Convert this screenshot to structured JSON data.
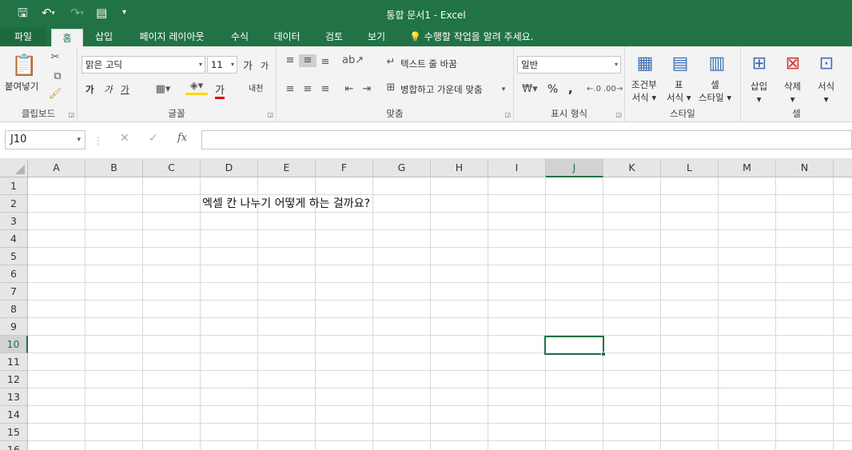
{
  "window": {
    "title": "통합 문서1 - Excel"
  },
  "qat": {
    "save_icon": "save-icon",
    "undo_icon": "undo-icon",
    "redo_icon": "redo-icon",
    "form_icon": "form-icon",
    "customize_icon": "customize-icon"
  },
  "tabs": [
    "파일",
    "홈",
    "삽입",
    "페이지 레이아웃",
    "수식",
    "데이터",
    "검토",
    "보기"
  ],
  "active_tab": "홈",
  "tell_me": "수행할 작업을 알려 주세요.",
  "ribbon": {
    "clipboard": {
      "label": "클립보드",
      "paste": "붙여넣기"
    },
    "font": {
      "label": "글꼴",
      "name": "맑은 고딕",
      "size": "11",
      "grow": "가",
      "shrink": "가",
      "bold": "가",
      "italic": "가",
      "underline": "가",
      "font_color": "가",
      "phonetic": "내천"
    },
    "alignment": {
      "label": "맞춤",
      "wrap_text": "텍스트 줄 바꿈",
      "merge_center": "병합하고 가운데 맞춤"
    },
    "number": {
      "label": "표시 형식",
      "format": "일반",
      "percent": "%",
      "comma": ","
    },
    "styles": {
      "label": "스타일",
      "cond_format": [
        "조건부",
        "서식"
      ],
      "format_table": [
        "표",
        "서식"
      ],
      "cell_styles": [
        "셀",
        "스타일"
      ]
    },
    "cells": {
      "label": "셀",
      "insert": "삽입",
      "delete": "삭제",
      "format": "서식"
    }
  },
  "formula_bar": {
    "name_box": "J10",
    "cancel": "✕",
    "enter": "✓",
    "fx": "fx",
    "value": ""
  },
  "sheet": {
    "columns": [
      "A",
      "B",
      "C",
      "D",
      "E",
      "F",
      "G",
      "H",
      "I",
      "J",
      "K",
      "L",
      "M",
      "N"
    ],
    "rows": [
      "1",
      "2",
      "3",
      "4",
      "5",
      "6",
      "7",
      "8",
      "9",
      "10",
      "11",
      "12",
      "13",
      "14",
      "15",
      "16"
    ],
    "selected_column": "J",
    "selected_row": "10",
    "cells": {
      "D2": "엑셀 칸 나누기 어떻게 하는 걸까요?"
    }
  },
  "colors": {
    "accent": "#217346"
  }
}
